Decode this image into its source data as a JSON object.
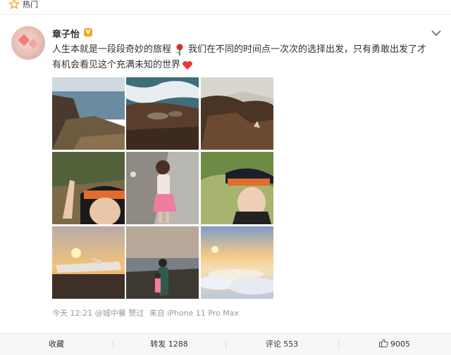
{
  "header": {
    "section_label": "热门",
    "icons": {
      "star": "star-icon"
    }
  },
  "post": {
    "author": "章子怡",
    "verified_badge": "V",
    "text_line1": "人生本就是一段段奇妙的旅程",
    "text_line1b": "我们在不同的时间点一次次的选择出发，只有勇敢出发了才",
    "text_line2": "有机会看见这个充满未知的世界",
    "timestamp": "今天 12:21",
    "by_user": "@城中餐",
    "liked": "赞过",
    "source": "来自 iPhone 11 Pro Max",
    "photo_count": 9
  },
  "actions": {
    "favorite": "收藏",
    "repost": "转发 1288",
    "comment": "评论 553",
    "like": "9005"
  },
  "colors": {
    "accent_orange": "#f5a623",
    "text": "#333333",
    "meta_gray": "#999999"
  }
}
